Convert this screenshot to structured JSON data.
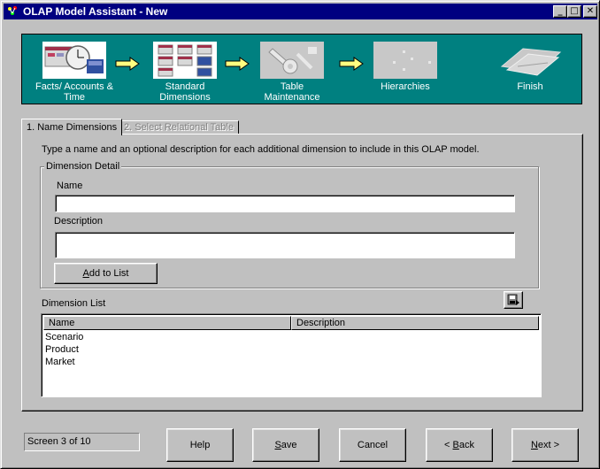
{
  "window": {
    "title": "OLAP Model Assistant - New",
    "controls": {
      "minimize": "_",
      "maximize": "□",
      "close": "✕"
    }
  },
  "wizard": {
    "steps": [
      {
        "label_line1": "Facts/ Accounts &",
        "label_line2": "Time",
        "state": "done",
        "icon": "clock-calendar-icon"
      },
      {
        "label_line1": "Standard",
        "label_line2": "Dimensions",
        "state": "current",
        "icon": "dimensions-icon"
      },
      {
        "label_line1": "Table",
        "label_line2": "Maintenance",
        "state": "pending",
        "icon": "wrench-icon"
      },
      {
        "label_line1": "Hierarchies",
        "label_line2": "",
        "state": "pending",
        "icon": "hierarchy-icon"
      },
      {
        "label_line1": "Finish",
        "label_line2": "",
        "state": "pending",
        "icon": "finish-icon"
      }
    ],
    "arrow_color": "#ffff80",
    "banner_color": "#008080"
  },
  "tabs": [
    {
      "label": "1. Name Dimensions",
      "active": true
    },
    {
      "label": "2. Select Relational Table",
      "active": false
    }
  ],
  "instructions": "Type a name and an optional description for each additional dimension to include in this OLAP model.",
  "detail": {
    "group_label": "Dimension Detail",
    "name_label": "Name",
    "name_value": "",
    "description_label": "Description",
    "description_value": "",
    "add_button": {
      "prefix": "",
      "mnemonic": "A",
      "rest": "dd to List"
    }
  },
  "dimension_list": {
    "label": "Dimension List",
    "columns": [
      "Name",
      "Description"
    ],
    "rows": [
      {
        "name": "Scenario",
        "description": ""
      },
      {
        "name": "Product",
        "description": ""
      },
      {
        "name": "Market",
        "description": ""
      }
    ]
  },
  "footer": {
    "status": "Screen 3 of 10",
    "buttons": {
      "help": {
        "prefix": "",
        "mnemonic": "",
        "rest": "Help"
      },
      "save": {
        "prefix": "",
        "mnemonic": "S",
        "rest": "ave"
      },
      "cancel": {
        "prefix": "",
        "mnemonic": "",
        "rest": "Cancel"
      },
      "back": {
        "prefix": "< ",
        "mnemonic": "B",
        "rest": "ack"
      },
      "next": {
        "prefix": "",
        "mnemonic": "N",
        "rest": "ext >"
      }
    }
  }
}
